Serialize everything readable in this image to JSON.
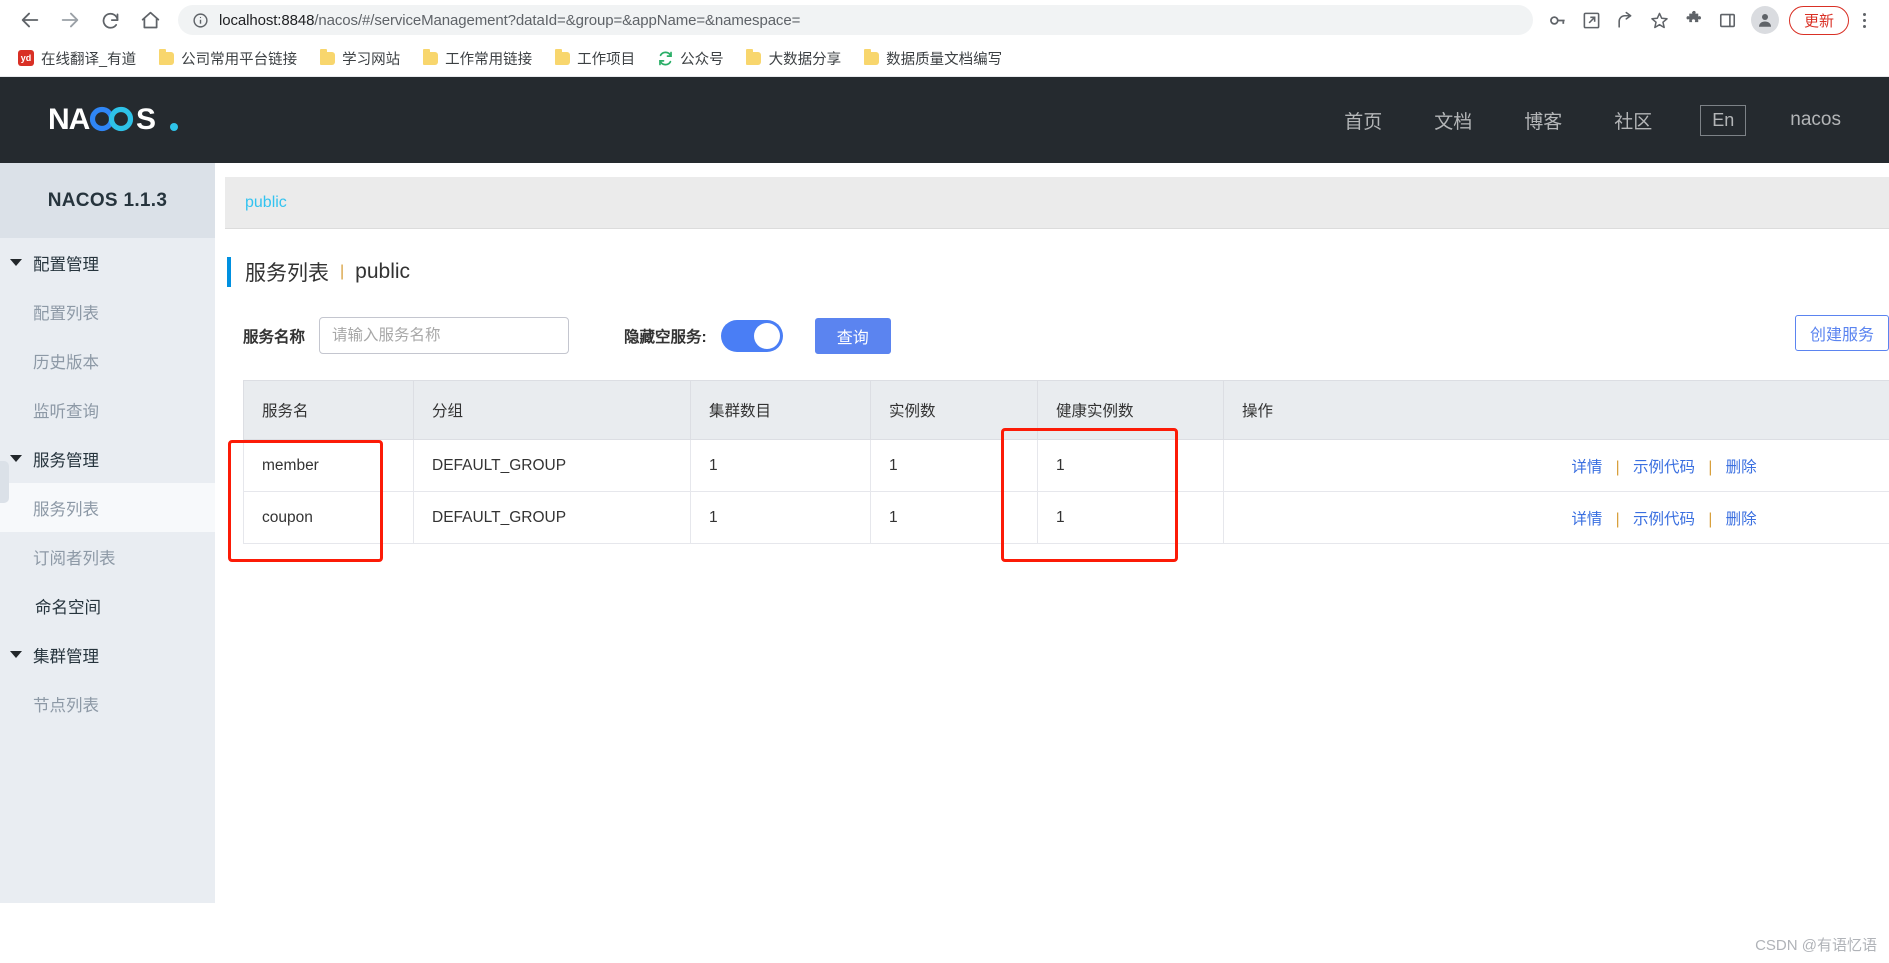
{
  "browser": {
    "back_icon": "back-arrow-icon",
    "forward_icon": "forward-arrow-icon",
    "reload_icon": "reload-icon",
    "home_icon": "home-icon",
    "url_host": "localhost:8848",
    "url_path": "/nacos/#/serviceManagement?dataId=&group=&appName=&namespace=",
    "update_button": "更新",
    "bookmarks": [
      {
        "label": "在线翻译_有道",
        "icon": "youdao-icon"
      },
      {
        "label": "公司常用平台链接",
        "icon": "folder-icon"
      },
      {
        "label": "学习网站",
        "icon": "folder-icon"
      },
      {
        "label": "工作常用链接",
        "icon": "folder-icon"
      },
      {
        "label": "工作项目",
        "icon": "folder-icon"
      },
      {
        "label": "公众号",
        "icon": "wechat-icon"
      },
      {
        "label": "大数据分享",
        "icon": "folder-icon"
      },
      {
        "label": "数据质量文档编写",
        "icon": "folder-icon"
      }
    ]
  },
  "header": {
    "logo_text": "NACOS.",
    "nav": [
      {
        "label": "首页"
      },
      {
        "label": "文档"
      },
      {
        "label": "博客"
      },
      {
        "label": "社区"
      }
    ],
    "language": "En",
    "user": "nacos"
  },
  "sidebar": {
    "version": "NACOS 1.1.3",
    "groups": [
      {
        "label": "配置管理",
        "items": [
          {
            "label": "配置列表",
            "active": false
          },
          {
            "label": "历史版本",
            "active": false
          },
          {
            "label": "监听查询",
            "active": false
          }
        ]
      },
      {
        "label": "服务管理",
        "items": [
          {
            "label": "服务列表",
            "active": true
          },
          {
            "label": "订阅者列表",
            "active": false
          }
        ]
      }
    ],
    "standalone": {
      "label": "命名空间"
    },
    "cluster_group": {
      "label": "集群管理",
      "items": [
        {
          "label": "节点列表",
          "active": false
        }
      ]
    }
  },
  "main": {
    "namespace_tab": "public",
    "title": "服务列表",
    "title_separator": "|",
    "title_namespace": "public",
    "search": {
      "name_label": "服务名称",
      "name_value": "",
      "name_placeholder": "请输入服务名称",
      "hide_empty_label": "隐藏空服务:",
      "hide_empty_on": true,
      "query_button": "查询",
      "create_button": "创建服务"
    },
    "table": {
      "columns": [
        "服务名",
        "分组",
        "集群数目",
        "实例数",
        "健康实例数",
        "操作"
      ],
      "rows": [
        {
          "service": "member",
          "group": "DEFAULT_GROUP",
          "clusters": "1",
          "instances": "1",
          "healthy": "1",
          "actions": [
            "详情",
            "示例代码",
            "删除"
          ]
        },
        {
          "service": "coupon",
          "group": "DEFAULT_GROUP",
          "clusters": "1",
          "instances": "1",
          "healthy": "1",
          "actions": [
            "详情",
            "示例代码",
            "删除"
          ]
        }
      ]
    }
  },
  "watermark": "CSDN @有语忆语",
  "colors": {
    "accent_blue": "#5b84f0",
    "link_blue": "#3a6fe0",
    "tab_cyan": "#33c3f0",
    "annotation_red": "#fc1b07",
    "header_dark": "#252a2f"
  }
}
